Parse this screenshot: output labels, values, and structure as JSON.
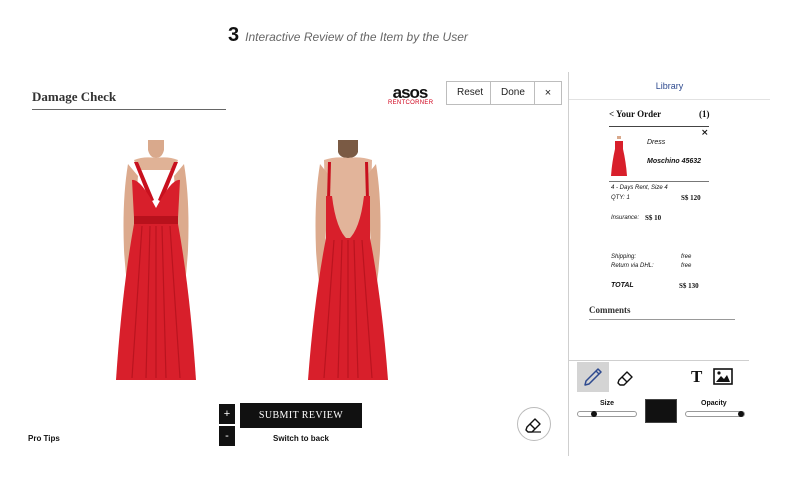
{
  "caption": {
    "step_number": "3",
    "text": "Interactive Review of the Item by the User"
  },
  "editor": {
    "title": "Damage Check",
    "brand": {
      "name": "asos",
      "sub": "RENTCORNER"
    },
    "toolbar": {
      "reset_label": "Reset",
      "done_label": "Done",
      "close_label": "×"
    },
    "zoom": {
      "in_label": "+",
      "out_label": "-"
    },
    "submit_label": "SUBMIT REVIEW",
    "switch_label": "Switch to back",
    "pro_tips_label": "Pro Tips",
    "images": [
      {
        "view": "front",
        "icon": "dress-front-illustration"
      },
      {
        "view": "back",
        "icon": "dress-back-illustration"
      }
    ]
  },
  "library": {
    "title": "Library",
    "order": {
      "heading": "< Your Order",
      "count": "(1)",
      "close_label": "×",
      "item": {
        "type": "Dress",
        "name": "Moschino 45632",
        "rent_info": "4 - Days Rent, Size 4",
        "qty_label": "QTY: 1",
        "price": "S$ 120",
        "insurance_label": "Insurance:",
        "insurance_price": "S$ 10"
      },
      "shipping_label": "Shipping:",
      "shipping_value": "free",
      "return_label": "Return via DHL:",
      "return_value": "free",
      "total_label": "TOTAL",
      "total_value": "S$ 130"
    },
    "comments_label": "Comments"
  },
  "tools": {
    "text_tool_label": "T",
    "size_label": "Size",
    "opacity_label": "Opacity",
    "size_level": 0.25,
    "opacity_level": 1.0,
    "current_color": "#111111",
    "active_tool": "pencil"
  },
  "colors": {
    "dress_red": "#d81f2b",
    "accent_blue": "#2e4a8f",
    "brand_red": "#d0021b"
  }
}
